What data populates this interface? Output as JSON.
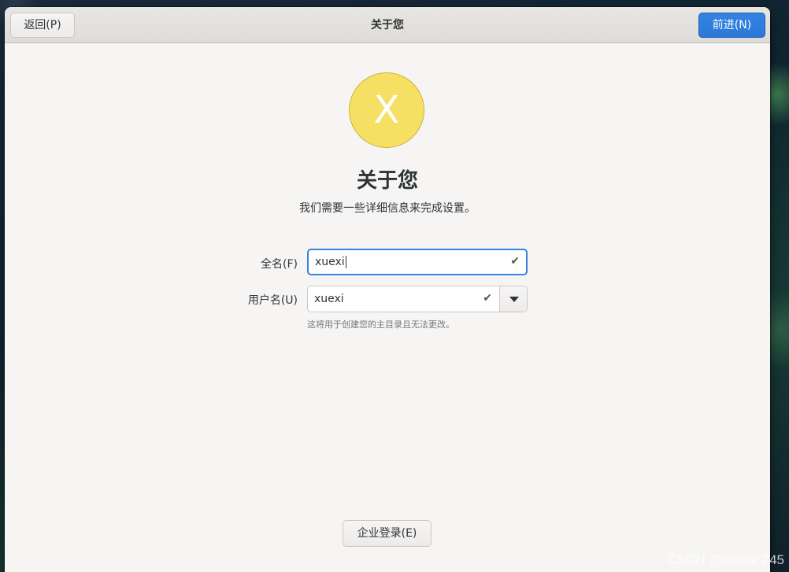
{
  "header": {
    "title": "关于您",
    "back_label": "返回(P)",
    "next_label": "前进(N)"
  },
  "avatar": {
    "initial": "X",
    "color": "#f6e064"
  },
  "main": {
    "title": "关于您",
    "subtitle": "我们需要一些详细信息来完成设置。"
  },
  "form": {
    "fullname_label": "全名(F)",
    "fullname_value": "xuexi",
    "username_label": "用户名(U)",
    "username_value": "xuexi",
    "username_hint": "这将用于创建您的主目录且无法更改。",
    "check_icon": "✔"
  },
  "footer": {
    "enterprise_label": "企业登录(E)"
  },
  "watermark": "CSDN @magic 245",
  "colors": {
    "accent": "#3584e4"
  }
}
